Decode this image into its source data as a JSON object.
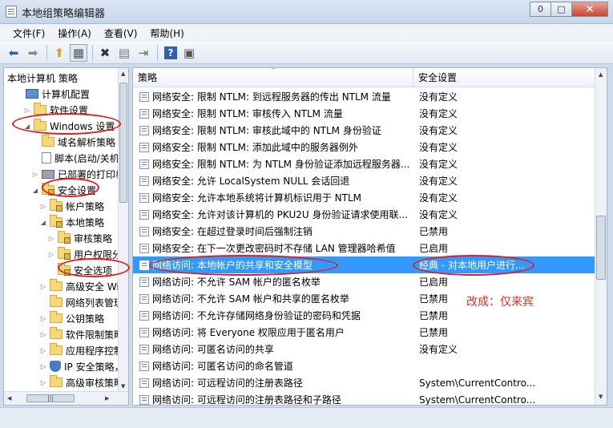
{
  "window": {
    "title": "本地组策略编辑器",
    "buttons": [
      "0",
      "□",
      "✕"
    ]
  },
  "menu": [
    "文件(F)",
    "操作(A)",
    "查看(V)",
    "帮助(H)"
  ],
  "toolbar_icons": [
    "back-icon",
    "forward-icon",
    "up-folder-icon",
    "show-tree-icon",
    "delete-icon",
    "properties-icon",
    "export-icon",
    "help-icon",
    "view-icon"
  ],
  "tree": [
    {
      "label": "本地计算机 策略",
      "indent": 0,
      "arrow": "",
      "icon": "none"
    },
    {
      "label": "计算机配置",
      "indent": 1,
      "arrow": "",
      "icon": "pc"
    },
    {
      "label": "软件设置",
      "indent": 2,
      "arrow": "▷",
      "icon": "folder"
    },
    {
      "label": "Windows 设置",
      "indent": 2,
      "arrow": "◢",
      "icon": "folder"
    },
    {
      "label": "域名解析策略",
      "indent": 3,
      "arrow": "",
      "icon": "folder"
    },
    {
      "label": "脚本(启动/关机)",
      "indent": 3,
      "arrow": "",
      "icon": "doc"
    },
    {
      "label": "已部署的打印机",
      "indent": 3,
      "arrow": "▷",
      "icon": "printer"
    },
    {
      "label": "安全设置",
      "indent": 3,
      "arrow": "◢",
      "icon": "lock"
    },
    {
      "label": "帐户策略",
      "indent": 4,
      "arrow": "▷",
      "icon": "lock"
    },
    {
      "label": "本地策略",
      "indent": 4,
      "arrow": "◢",
      "icon": "lock"
    },
    {
      "label": "审核策略",
      "indent": 5,
      "arrow": "▷",
      "icon": "lock"
    },
    {
      "label": "用户权限分配",
      "indent": 5,
      "arrow": "▷",
      "icon": "lock"
    },
    {
      "label": "安全选项",
      "indent": 5,
      "arrow": "",
      "icon": "lock"
    },
    {
      "label": "高级安全 Windows 防火墙",
      "indent": 4,
      "arrow": "▷",
      "icon": "folder"
    },
    {
      "label": "网络列表管理器策略",
      "indent": 4,
      "arrow": "",
      "icon": "folder"
    },
    {
      "label": "公钥策略",
      "indent": 4,
      "arrow": "▷",
      "icon": "folder"
    },
    {
      "label": "软件限制策略",
      "indent": 4,
      "arrow": "▷",
      "icon": "folder"
    },
    {
      "label": "应用程序控制策略",
      "indent": 4,
      "arrow": "▷",
      "icon": "folder"
    },
    {
      "label": "IP 安全策略，在 本地计算机",
      "indent": 4,
      "arrow": "▷",
      "icon": "shield"
    },
    {
      "label": "高级审核策略配置",
      "indent": 4,
      "arrow": "▷",
      "icon": "folder"
    }
  ],
  "columns": {
    "policy": "策略",
    "setting": "安全设置"
  },
  "policies": [
    {
      "name": "网络安全: 限制 NTLM: 到远程服务器的传出 NTLM 流量",
      "setting": "没有定义"
    },
    {
      "name": "网络安全: 限制 NTLM: 审核传入 NTLM 流量",
      "setting": "没有定义"
    },
    {
      "name": "网络安全: 限制 NTLM: 审核此域中的 NTLM 身份验证",
      "setting": "没有定义"
    },
    {
      "name": "网络安全: 限制 NTLM: 添加此域中的服务器例外",
      "setting": "没有定义"
    },
    {
      "name": "网络安全: 限制 NTLM: 为 NTLM 身份验证添加远程服务器...",
      "setting": "没有定义"
    },
    {
      "name": "网络安全: 允许 LocalSystem NULL 会话回退",
      "setting": "没有定义"
    },
    {
      "name": "网络安全: 允许本地系统将计算机标识用于 NTLM",
      "setting": "没有定义"
    },
    {
      "name": "网络安全: 允许对该计算机的 PKU2U 身份验证请求使用联...",
      "setting": "没有定义"
    },
    {
      "name": "网络安全: 在超过登录时间后强制注销",
      "setting": "已禁用"
    },
    {
      "name": "网络安全: 在下一次更改密码时不存储 LAN 管理器哈希值",
      "setting": "已启用"
    },
    {
      "name": "网络访问: 本地帐户的共享和安全模型",
      "setting": "经典 - 对本地用户进行...",
      "selected": true
    },
    {
      "name": "网络访问: 不允许 SAM 帐户的匿名枚举",
      "setting": "已启用"
    },
    {
      "name": "网络访问: 不允许 SAM 帐户和共享的匿名枚举",
      "setting": "已禁用"
    },
    {
      "name": "网络访问: 不允许存储网络身份验证的密码和凭据",
      "setting": "已禁用"
    },
    {
      "name": "网络访问: 将 Everyone 权限应用于匿名用户",
      "setting": "已禁用"
    },
    {
      "name": "网络访问: 可匿名访问的共享",
      "setting": "没有定义"
    },
    {
      "name": "网络访问: 可匿名访问的命名管道",
      "setting": ""
    },
    {
      "name": "网络访问: 可远程访问的注册表路径",
      "setting": "System\\CurrentContro..."
    },
    {
      "name": "网络访问: 可远程访问的注册表路径和子路径",
      "setting": "System\\CurrentContro..."
    }
  ],
  "annotation": {
    "text": "改成：仅来宾",
    "color": "#e0301e"
  },
  "colors": {
    "selection": "#3399ff",
    "highlight_ellipse": "#e11e1e"
  }
}
